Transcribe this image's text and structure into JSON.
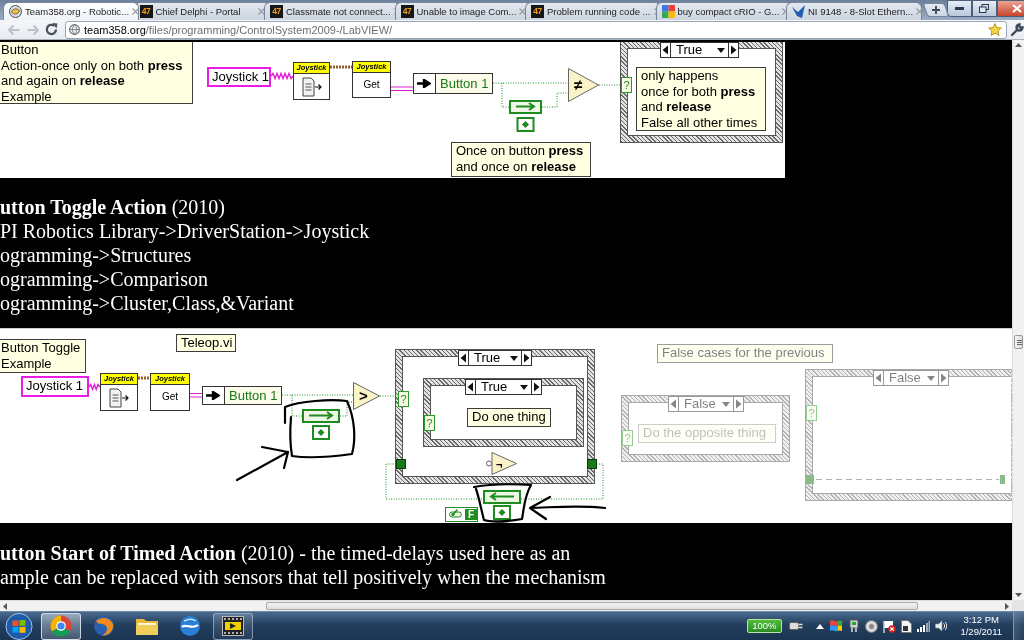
{
  "browser": {
    "tabs": [
      {
        "favicon": {
          "kind": "disc"
        },
        "title": "Team358.org - Robotic...",
        "selected": true
      },
      {
        "favicon": {
          "kind": "badge",
          "text": "47"
        },
        "title": "Chief Delphi - Portal",
        "selected": false
      },
      {
        "favicon": {
          "kind": "badge",
          "text": "47"
        },
        "title": "Classmate not connect...",
        "selected": false
      },
      {
        "favicon": {
          "kind": "badge",
          "text": "47"
        },
        "title": "Unable to image Com...",
        "selected": false
      },
      {
        "favicon": {
          "kind": "badge",
          "text": "47"
        },
        "title": "Problem running code ...",
        "selected": false
      },
      {
        "favicon": {
          "kind": "squares"
        },
        "title": "buy compact cRIO - G...",
        "selected": false
      },
      {
        "favicon": {
          "kind": "wing"
        },
        "title": "NI 9148 - 8-Slot Ethern...",
        "selected": false
      }
    ],
    "nav_buttons": [
      {
        "kind": "back",
        "disabled": true
      },
      {
        "kind": "forward",
        "disabled": true
      },
      {
        "kind": "reload",
        "disabled": false
      }
    ],
    "address": {
      "host": "team358.org",
      "path": "/files/programming/ControlSystem2009-/LabVIEW/"
    }
  },
  "page": {
    "diagram_1": {
      "nodes": [
        {
          "kind": "comment",
          "text": "Button\nAction-once only on both **press**\nand again on **release**\nExample"
        },
        {
          "kind": "control",
          "label": "Joystick 1"
        },
        {
          "kind": "vi",
          "header": "Joystick"
        },
        {
          "kind": "vi",
          "header": "Joystick",
          "body": "Get"
        },
        {
          "kind": "unbundle",
          "label": "Button 1"
        },
        {
          "kind": "compare",
          "symbol": "≠"
        },
        {
          "kind": "feedback"
        },
        {
          "kind": "case",
          "selector": "True",
          "terminal": "?",
          "children": [
            {
              "kind": "comment",
              "text": "only happens\nonce for both **press**\nand **release**\nFalse all other times"
            }
          ]
        },
        {
          "kind": "comment",
          "text": "Once on button **press**\nand once on **release**"
        }
      ]
    },
    "section_1": {
      "heading": "**utton Toggle Action** (2010)",
      "lines": [
        "PI Robotics Library->DriverStation->Joystick",
        "ogramming->Structures",
        "ogramming->Comparison",
        "ogramming->Cluster,Class,&Variant"
      ]
    },
    "diagram_2": {
      "nodes": [
        {
          "kind": "comment",
          "text": "Button Toggle\nExample"
        },
        {
          "kind": "comment",
          "text": "Teleop.vi"
        },
        {
          "kind": "control",
          "label": "Joystick 1"
        },
        {
          "kind": "vi",
          "header": "Joystick"
        },
        {
          "kind": "vi",
          "header": "Joystick",
          "body": "Get"
        },
        {
          "kind": "unbundle",
          "label": "Button 1"
        },
        {
          "kind": "compare",
          "symbol": ">"
        },
        {
          "kind": "feedback"
        },
        {
          "kind": "case",
          "selector": "True",
          "terminal": "?",
          "children": [
            {
              "kind": "case",
              "selector": "True",
              "terminal": "?",
              "children": [
                {
                  "kind": "comment",
                  "text": "Do one thing"
                }
              ]
            }
          ]
        },
        {
          "kind": "register"
        },
        {
          "kind": "register"
        },
        {
          "kind": "not",
          "symbol": "¬"
        },
        {
          "kind": "feedback"
        },
        {
          "kind": "constant",
          "value": "F"
        }
      ],
      "false_cases": [
        {
          "kind": "comment",
          "text": "False cases for the previous"
        },
        {
          "kind": "case",
          "selector": "False",
          "terminal": "?",
          "children": [
            {
              "kind": "comment",
              "text": "Do the opposite thing"
            }
          ]
        },
        {
          "kind": "case",
          "selector": "False",
          "terminal": "?"
        }
      ]
    },
    "section_2": {
      "paragraph": "**utton Start of Timed Action** (2010) - the timed-delays used here as an\nample can be replaced with sensors that tell positively when the mechanism"
    }
  },
  "taskbar": {
    "apps": [
      {
        "kind": "round",
        "selected": true,
        "running": true
      },
      {
        "kind": "globe",
        "selected": false,
        "running": false
      },
      {
        "kind": "folder",
        "selected": false,
        "running": false
      },
      {
        "kind": "orb",
        "selected": false,
        "running": false
      },
      {
        "kind": "film",
        "selected": false,
        "running": true
      }
    ],
    "battery": "100%",
    "time": "3:12 PM",
    "date": "1/29/2011"
  }
}
